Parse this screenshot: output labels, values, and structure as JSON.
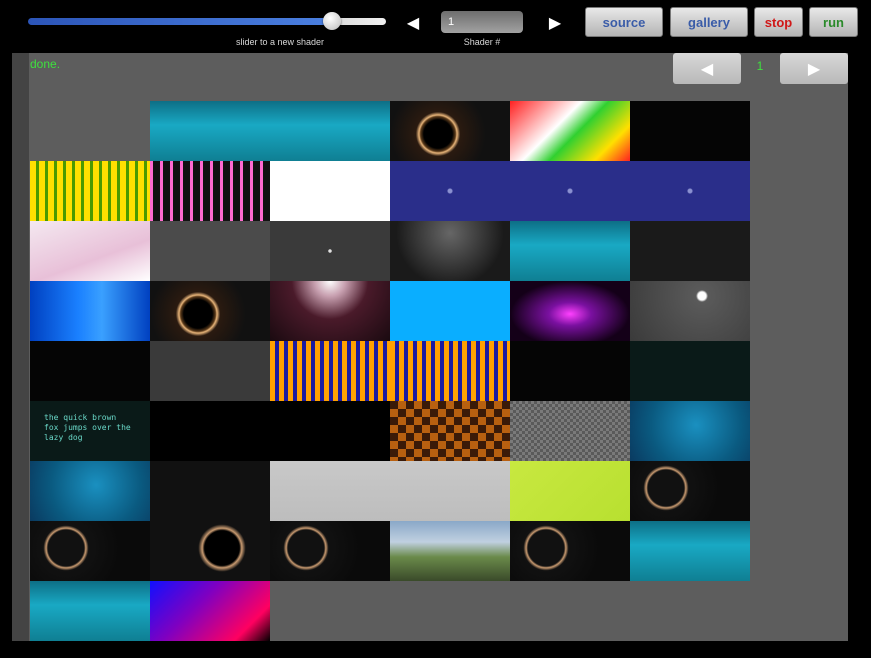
{
  "toolbar": {
    "slider_caption": "slider to a new shader",
    "slider_value": 0.84,
    "prev_icon": "◀",
    "next_icon": "▶",
    "shader_number": "1",
    "shader_caption": "Shader #",
    "source_label": "source",
    "gallery_label": "gallery",
    "stop_label": "stop",
    "run_label": "run",
    "colors": {
      "source": "#3a5ca8",
      "gallery": "#3a5ca8",
      "stop": "#d01818",
      "run": "#2a8a2a"
    }
  },
  "status": {
    "text": "done."
  },
  "pager": {
    "prev_icon": "◀",
    "page": "1",
    "next_icon": "▶"
  },
  "gallery": {
    "tiles": [
      {
        "style": "cyan-top",
        "text": ""
      },
      {
        "style": "cyan-top",
        "text": ""
      },
      {
        "style": "mandel-orange",
        "text": ""
      },
      {
        "style": "rainbow-diag",
        "text": ""
      },
      {
        "style": "black",
        "text": ""
      },
      {
        "style": "plaid-yellow",
        "text": ""
      },
      {
        "style": "plaid-pink",
        "text": ""
      },
      {
        "style": "graph-white",
        "text": ""
      },
      {
        "style": "hex-blue",
        "text": ""
      },
      {
        "style": "hex-blue",
        "text": ""
      },
      {
        "style": "hex-blue",
        "text": ""
      },
      {
        "style": "pink-soft",
        "text": ""
      },
      {
        "style": "gray-dot",
        "text": ""
      },
      {
        "style": "dots-gray",
        "text": ""
      },
      {
        "style": "spheres-dark",
        "text": ""
      },
      {
        "style": "cyan-top",
        "text": ""
      },
      {
        "style": "glyph-dark",
        "text": ""
      },
      {
        "style": "blue-noise",
        "text": ""
      },
      {
        "style": "mandel-orange",
        "text": ""
      },
      {
        "style": "maroon-glow",
        "text": ""
      },
      {
        "style": "cyan-solid",
        "text": ""
      },
      {
        "style": "magenta-flare",
        "text": ""
      },
      {
        "style": "stars-gray",
        "text": ""
      },
      {
        "style": "black",
        "text": ""
      },
      {
        "style": "dark-gray",
        "text": ""
      },
      {
        "style": "plaid-orange",
        "text": ""
      },
      {
        "style": "plaid-orange",
        "text": ""
      },
      {
        "style": "leaves-dark",
        "text": ""
      },
      {
        "style": "teal-text",
        "text": ""
      },
      {
        "style": "teal-text",
        "text": "the quick brown fox jumps over the lazy dog"
      },
      {
        "style": "gears",
        "text": ""
      },
      {
        "style": "gears",
        "text": ""
      },
      {
        "style": "checker-orange",
        "text": ""
      },
      {
        "style": "checker-gray",
        "text": ""
      },
      {
        "style": "blue-rays",
        "text": ""
      },
      {
        "style": "blue-rays",
        "text": ""
      },
      {
        "style": "figure-dark",
        "text": ""
      },
      {
        "style": "light-gray",
        "text": ""
      },
      {
        "style": "light-gray",
        "text": ""
      },
      {
        "style": "lime",
        "text": ""
      },
      {
        "style": "rings-dark",
        "text": ""
      },
      {
        "style": "rings-dark",
        "text": ""
      },
      {
        "style": "mandel-dark",
        "text": ""
      },
      {
        "style": "rings-dark",
        "text": ""
      },
      {
        "style": "landscape",
        "text": ""
      },
      {
        "style": "rings-dark",
        "text": ""
      },
      {
        "style": "cyan-top",
        "text": ""
      },
      {
        "style": "cyan-top",
        "text": ""
      },
      {
        "style": "gradient-bm",
        "text": ""
      }
    ]
  }
}
